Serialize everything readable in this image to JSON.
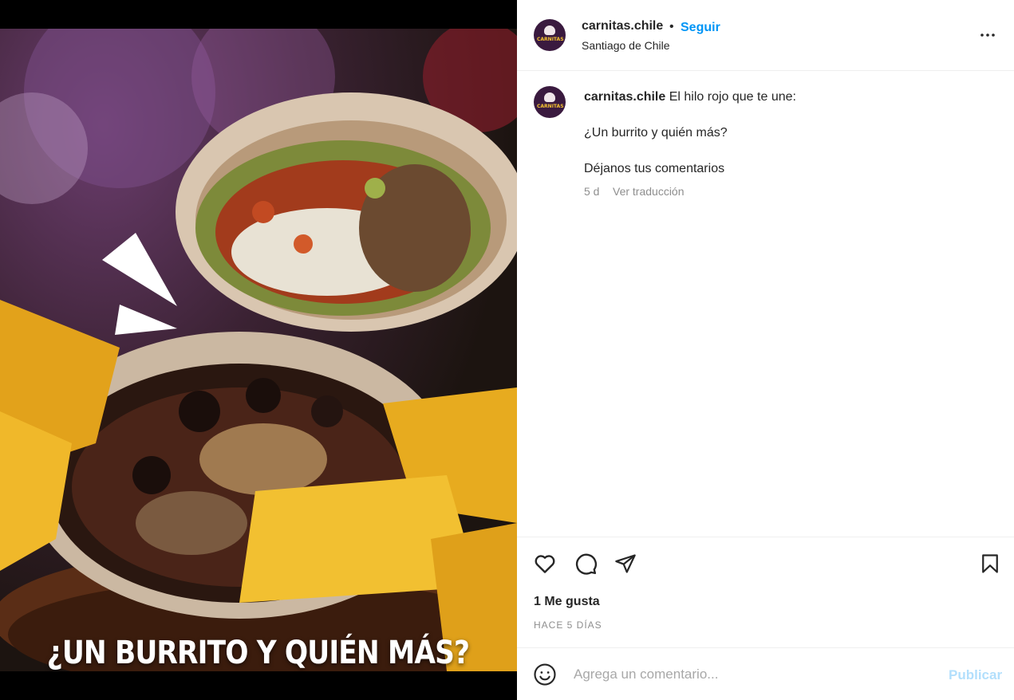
{
  "post": {
    "overlay_text": "¿UN BURRITO Y QUIÉN MÁS?",
    "image_description": "food-photo"
  },
  "header": {
    "username": "carnitas.chile",
    "separator": "•",
    "follow_label": "Seguir",
    "location": "Santiago de Chile",
    "avatar_brand": "CARNITAS"
  },
  "caption": {
    "username": "carnitas.chile",
    "text_line1": "El hilo rojo que te une:",
    "text_line2": "¿Un burrito y quién más?",
    "text_line3": "Déjanos tus comentarios",
    "time": "5 d",
    "translate_label": "Ver traducción"
  },
  "actions": {
    "like_icon": "heart-icon",
    "comment_icon": "comment-bubble-icon",
    "share_icon": "paper-plane-icon",
    "save_icon": "bookmark-icon",
    "likes_label": "1 Me gusta",
    "posted_ago": "HACE 5 DÍAS"
  },
  "comment_box": {
    "placeholder": "Agrega un comentario...",
    "publish_label": "Publicar",
    "emoji_icon": "smiley-icon"
  },
  "colors": {
    "accent": "#0095f6",
    "publish_disabled": "#b2dffc",
    "muted_text": "#8e8e8e",
    "divider": "#efefef"
  }
}
